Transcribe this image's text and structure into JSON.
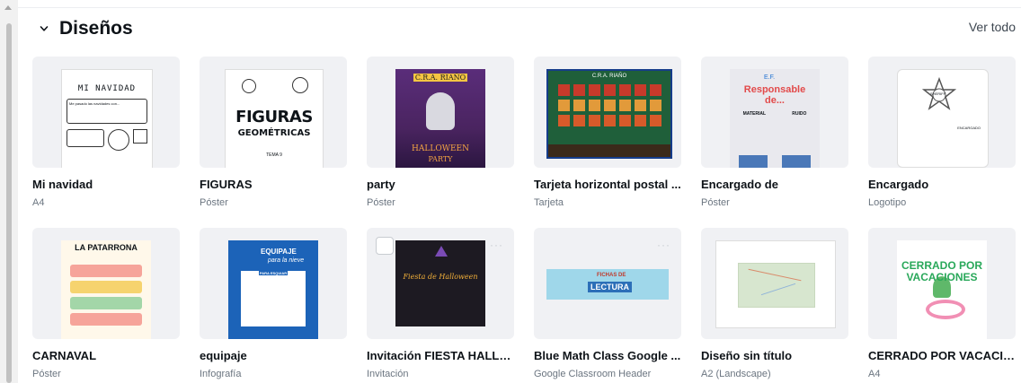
{
  "section": {
    "title": "Diseños",
    "see_all": "Ver todo"
  },
  "designs": [
    {
      "name": "Mi navidad",
      "type": "A4",
      "thumb_title": "MI NAVIDAD",
      "thumb_line": "Me pasado las navidades con..."
    },
    {
      "name": "FIGURAS",
      "type": "Póster",
      "thumb_title": "FIGURAS",
      "thumb_subtitle": "GEOMÉTRICAS",
      "thumb_note": "TEMA 9"
    },
    {
      "name": "party",
      "type": "Póster",
      "thumb_title": "C.R.A. RIAÑO",
      "thumb_subtitle": "HALLOWEEN",
      "thumb_note": "PARTY"
    },
    {
      "name": "Tarjeta horizontal postal ...",
      "type": "Tarjeta",
      "thumb_title": "C.R.A. RIAÑO"
    },
    {
      "name": "Encargado de",
      "type": "Póster",
      "thumb_title": "Responsable de...",
      "thumb_subtitle": "E.F.",
      "thumb_note": "MATERIAL",
      "thumb_note2": "RUIDO"
    },
    {
      "name": "Encargado",
      "type": "Logotipo",
      "thumb_title": "ENCARGADO",
      "thumb_subtitle": "SHERIFF"
    },
    {
      "name": "CARNAVAL",
      "type": "Póster",
      "thumb_title": "LA PATARRONA"
    },
    {
      "name": "equipaje",
      "type": "Infografía",
      "thumb_title": "EQUIPAJE",
      "thumb_subtitle": "para la nieve",
      "thumb_note": "PARA ESQUIAR"
    },
    {
      "name": "Invitación FIESTA HALLO...",
      "type": "Invitación",
      "thumb_title": "Fiesta de Halloween"
    },
    {
      "name": "Blue Math Class Google ...",
      "type": "Google Classroom Header",
      "thumb_title": "FICHAS DE",
      "thumb_subtitle": "LECTURA"
    },
    {
      "name": "Diseño sin título",
      "type": "A2 (Landscape)"
    },
    {
      "name": "CERRADO POR VACACIO...",
      "type": "A4",
      "thumb_title": "CERRADO POR VACACIONES"
    }
  ],
  "colors": {
    "title": "#0e1318",
    "muted": "#6b7580",
    "thumb_bg": "#f0f1f4"
  }
}
